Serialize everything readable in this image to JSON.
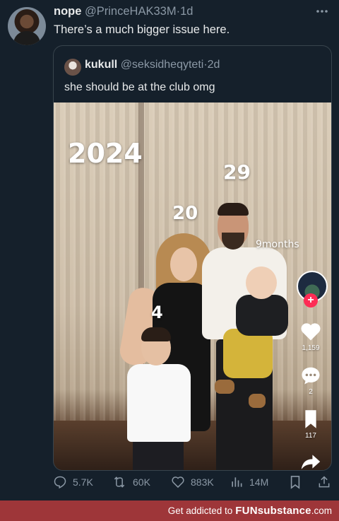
{
  "tweet": {
    "display_name": "nope",
    "handle": "@PrinceHAK33M",
    "separator": "·",
    "time": "1d",
    "text": "There’s a much bigger issue here.",
    "more_icon": "more-horizontal-icon"
  },
  "quote": {
    "display_name": "kukull",
    "handle": "@seksidheqyteti",
    "separator": "·",
    "time": "2d",
    "text": "she should be at the club omg",
    "photo": {
      "overlay": {
        "year": "2024",
        "age_man": "29",
        "age_woman": "20",
        "age_baby": "9months",
        "age_boy": "4"
      },
      "tiktok": {
        "plus": "+",
        "likes": "1,159",
        "comments": "2",
        "saves": "117"
      }
    }
  },
  "actions": {
    "replies": "5.7K",
    "reposts": "60K",
    "likes": "883K",
    "views": "14M"
  },
  "footer": {
    "text": "Get addicted to",
    "brand": "FUNsubstance",
    "domain": ".com"
  },
  "colors": {
    "background": "#15202b",
    "muted": "#8b98a5",
    "border": "#38444d",
    "footer": "#9e3639",
    "tiktok_red": "#fe2c55"
  }
}
